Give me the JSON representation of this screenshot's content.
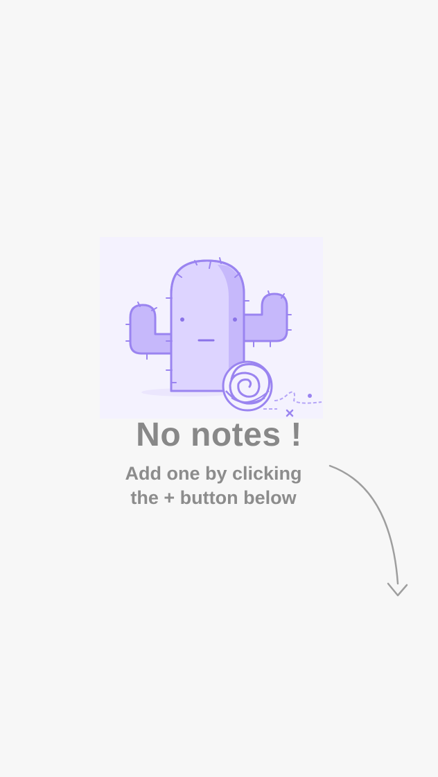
{
  "empty_state": {
    "title": "No notes !",
    "subtitle_line1": "Add one by clicking",
    "subtitle_line2": "the + button below",
    "illustration_icon": "cactus-icon",
    "arrow_icon": "curved-arrow-down-icon"
  },
  "colors": {
    "background": "#f7f7f7",
    "text": "#888888",
    "illustration_stroke": "#9a84f0",
    "illustration_fill": "#ddd4ff",
    "illustration_shade": "#c6b8fb",
    "illustration_bg": "#f4f2fe",
    "arrow": "#9e9e9e"
  }
}
